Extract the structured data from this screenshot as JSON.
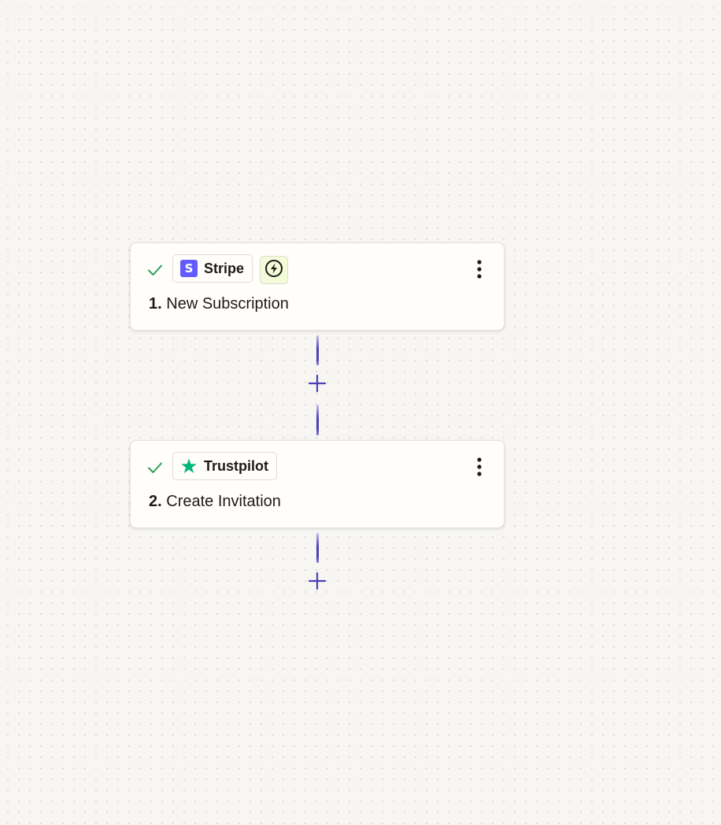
{
  "workflow": {
    "steps": [
      {
        "app": {
          "name": "Stripe",
          "logo_icon": "stripe-logo-icon",
          "logo_letter": "S",
          "brand_color": "#635bff"
        },
        "status_icon": "checkmark-icon",
        "has_instant_trigger_badge": true,
        "instant_icon": "lightning-bolt-icon",
        "number": "1.",
        "title": "New Subscription",
        "menu_icon": "more-vertical-icon"
      },
      {
        "app": {
          "name": "Trustpilot",
          "logo_icon": "trustpilot-star-icon",
          "brand_color": "#00b67a"
        },
        "status_icon": "checkmark-icon",
        "has_instant_trigger_badge": false,
        "number": "2.",
        "title": "Create Invitation",
        "menu_icon": "more-vertical-icon"
      }
    ],
    "add_step_icon": "plus-icon",
    "colors": {
      "canvas_background": "#f7f6f3",
      "connector": "#4b40b7",
      "check": "#2e9e5b",
      "instant_badge_bg": "#f3fbd9"
    }
  }
}
